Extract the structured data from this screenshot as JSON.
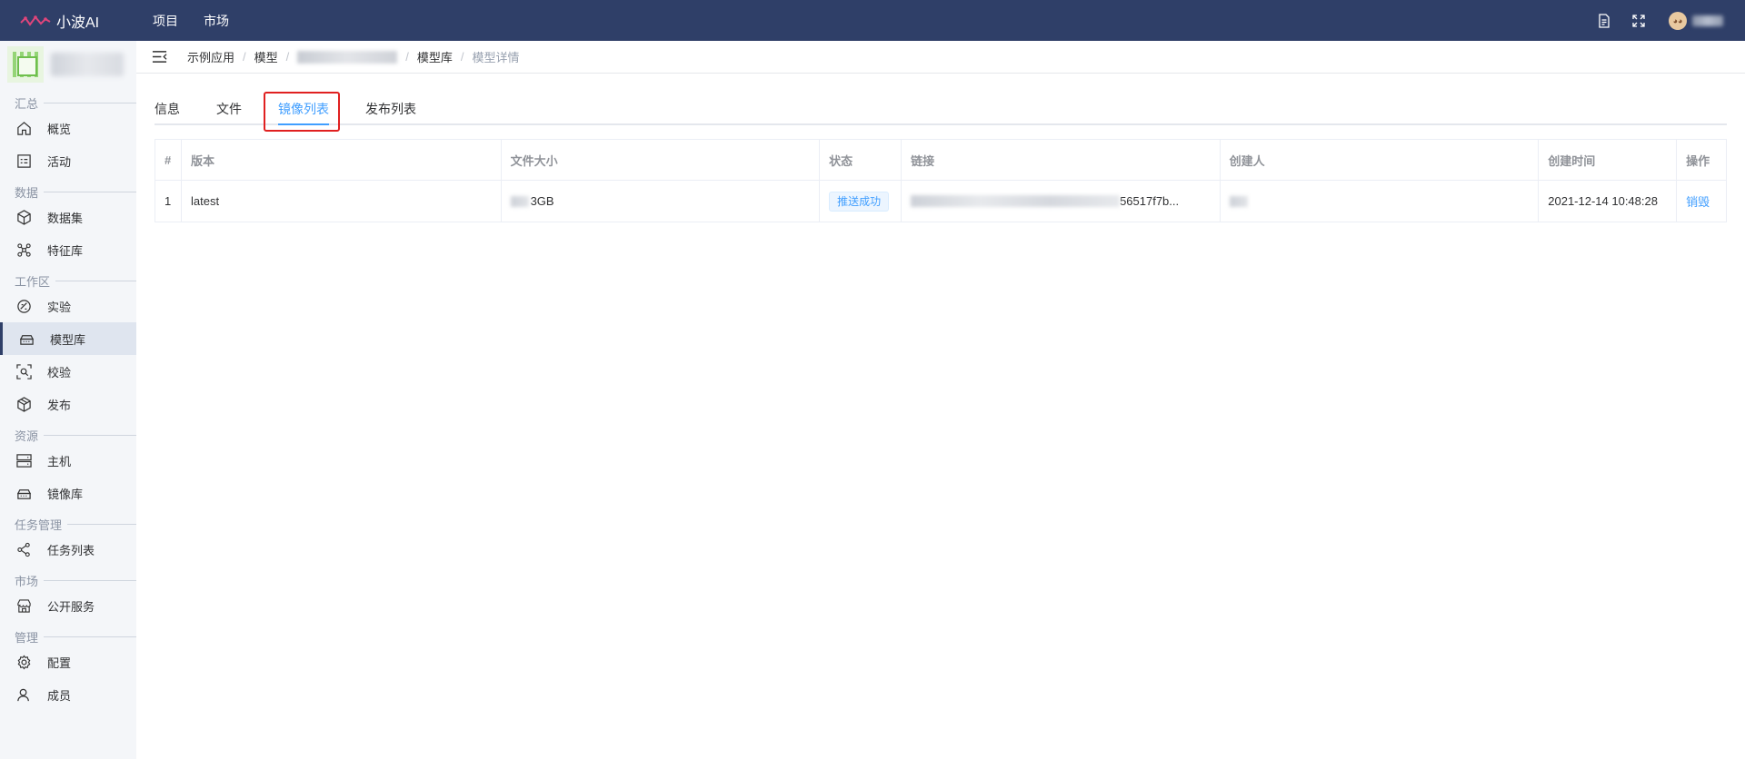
{
  "app": {
    "name": "小波AI"
  },
  "topnav": {
    "items": [
      "项目",
      "市场"
    ]
  },
  "colors": {
    "topbar": "#2f3f68",
    "accent": "#409eff",
    "highlight": "#e02020",
    "sidebar_bg": "#f4f6f9"
  },
  "sidebar": {
    "groups": [
      {
        "label": "汇总",
        "items": [
          {
            "label": "概览",
            "icon": "home-icon"
          },
          {
            "label": "活动",
            "icon": "activity-icon"
          }
        ]
      },
      {
        "label": "数据",
        "items": [
          {
            "label": "数据集",
            "icon": "cube-icon"
          },
          {
            "label": "特征库",
            "icon": "graph-icon"
          }
        ]
      },
      {
        "label": "工作区",
        "items": [
          {
            "label": "实验",
            "icon": "experiment-icon"
          },
          {
            "label": "模型库",
            "icon": "model-icon",
            "active": true
          },
          {
            "label": "校验",
            "icon": "scan-icon"
          },
          {
            "label": "发布",
            "icon": "package-icon"
          }
        ]
      },
      {
        "label": "资源",
        "items": [
          {
            "label": "主机",
            "icon": "server-icon"
          },
          {
            "label": "镜像库",
            "icon": "image-repo-icon"
          }
        ]
      },
      {
        "label": "任务管理",
        "items": [
          {
            "label": "任务列表",
            "icon": "share-icon"
          }
        ]
      },
      {
        "label": "市场",
        "items": [
          {
            "label": "公开服务",
            "icon": "store-icon"
          }
        ]
      },
      {
        "label": "管理",
        "items": [
          {
            "label": "配置",
            "icon": "gear-icon"
          },
          {
            "label": "成员",
            "icon": "user-icon"
          }
        ]
      }
    ]
  },
  "breadcrumb": {
    "items": [
      "示例应用",
      "模型",
      "模型库",
      "模型详情"
    ]
  },
  "tabs": [
    "信息",
    "文件",
    "镜像列表",
    "发布列表"
  ],
  "table": {
    "headers": [
      "#",
      "版本",
      "文件大小",
      "状态",
      "链接",
      "创建人",
      "创建时间",
      "操作"
    ],
    "rows": [
      {
        "index": "1",
        "version": "latest",
        "size": "3GB",
        "status": "推送成功",
        "link": "56517f7b...",
        "created_at": "2021-12-14 10:48:28",
        "action": "销毁"
      }
    ]
  }
}
